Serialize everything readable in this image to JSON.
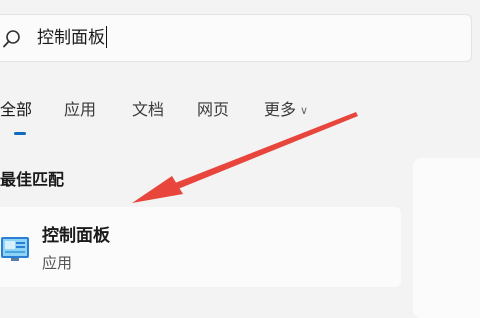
{
  "search": {
    "query": "控制面板"
  },
  "tabs": [
    {
      "label": "全部"
    },
    {
      "label": "应用"
    },
    {
      "label": "文档"
    },
    {
      "label": "网页"
    },
    {
      "label": "更多"
    }
  ],
  "best_match": {
    "heading": "最佳匹配",
    "result": {
      "title": "控制面板",
      "subtitle": "应用",
      "icon": "control-panel-icon"
    }
  },
  "colors": {
    "accent": "#0f6cbd",
    "annotation_arrow": "#e8463c"
  }
}
